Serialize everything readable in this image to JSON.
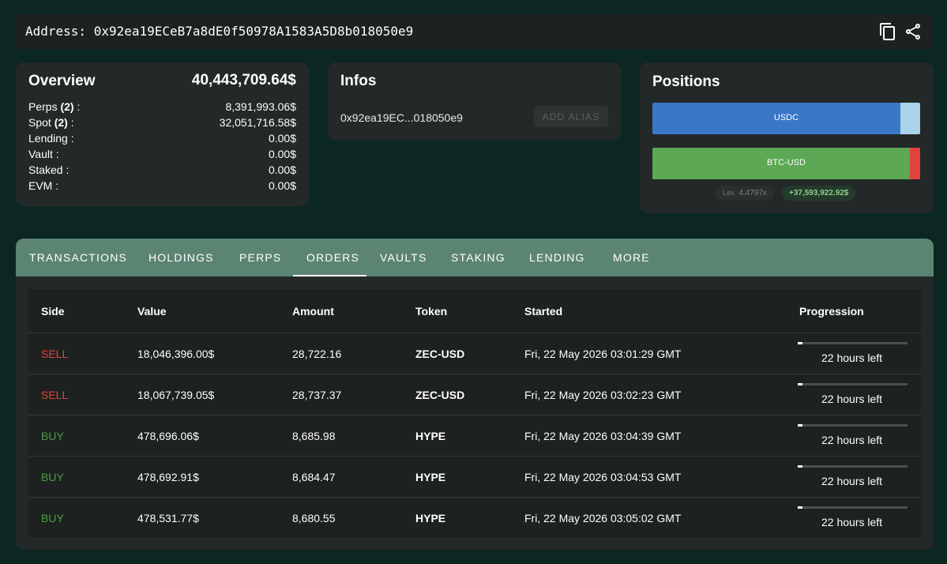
{
  "address_bar": {
    "label": "Address:",
    "address": "0x92ea19ECeB7a8dE0f50978A1583A5D8b018050e9"
  },
  "overview": {
    "title": "Overview",
    "total": "40,443,709.64$",
    "rows": [
      {
        "label": "Perps",
        "count": "(2)",
        "suffix": " :",
        "value": "8,391,993.06$"
      },
      {
        "label": "Spot",
        "count": "(2)",
        "suffix": " :",
        "value": "32,051,716.58$"
      },
      {
        "label": "Lending",
        "count": "",
        "suffix": " :",
        "value": "0.00$"
      },
      {
        "label": "Vault",
        "count": "",
        "suffix": " :",
        "value": "0.00$"
      },
      {
        "label": "Staked",
        "count": "",
        "suffix": " :",
        "value": "0.00$"
      },
      {
        "label": "EVM",
        "count": "",
        "suffix": " :",
        "value": "0.00$"
      }
    ]
  },
  "infos": {
    "title": "Infos",
    "short_address": "0x92ea19EC...018050e9",
    "add_alias_label": "ADD ALIAS"
  },
  "positions": {
    "title": "Positions",
    "bars": [
      {
        "label": "USDC",
        "fill_fraction": 0.925,
        "fill_color": "#3a77c8",
        "rest_color": "#acd3ec"
      },
      {
        "label": "BTC-USD",
        "fill_fraction": 0.962,
        "fill_color": "#5ca854",
        "rest_color": "#e2443b"
      }
    ],
    "leverage_prefix": "Lev.",
    "leverage_value": "4.4797x",
    "pnl": "+37,593,922.92$"
  },
  "tabs": [
    {
      "label": "TRANSACTIONS"
    },
    {
      "label": "HOLDINGS"
    },
    {
      "label": "PERPS"
    },
    {
      "label": "ORDERS"
    },
    {
      "label": "VAULTS"
    },
    {
      "label": "STAKING"
    },
    {
      "label": "LENDING"
    },
    {
      "label": "MORE"
    }
  ],
  "active_tab": "ORDERS",
  "orders": {
    "headers": {
      "side": "Side",
      "value": "Value",
      "amount": "Amount",
      "token": "Token",
      "started": "Started",
      "progression": "Progression"
    },
    "rows": [
      {
        "side": "SELL",
        "value": "18,046,396.00$",
        "amount": "28,722.16",
        "token": "ZEC-USD",
        "started": "Fri, 22 May 2026 03:01:29 GMT",
        "progress": 0.04,
        "time_left": "22 hours left"
      },
      {
        "side": "SELL",
        "value": "18,067,739.05$",
        "amount": "28,737.37",
        "token": "ZEC-USD",
        "started": "Fri, 22 May 2026 03:02:23 GMT",
        "progress": 0.04,
        "time_left": "22 hours left"
      },
      {
        "side": "BUY",
        "value": "478,696.06$",
        "amount": "8,685.98",
        "token": "HYPE",
        "started": "Fri, 22 May 2026 03:04:39 GMT",
        "progress": 0.04,
        "time_left": "22 hours left"
      },
      {
        "side": "BUY",
        "value": "478,692.91$",
        "amount": "8,684.47",
        "token": "HYPE",
        "started": "Fri, 22 May 2026 03:04:53 GMT",
        "progress": 0.04,
        "time_left": "22 hours left"
      },
      {
        "side": "BUY",
        "value": "478,531.77$",
        "amount": "8,680.55",
        "token": "HYPE",
        "started": "Fri, 22 May 2026 03:05:02 GMT",
        "progress": 0.04,
        "time_left": "22 hours left"
      }
    ]
  },
  "colors": {
    "background": "#0c2722",
    "card": "#232928",
    "tab_bar": "#5b8473",
    "sell": "#e2443b",
    "buy": "#4d9a45"
  },
  "icons": {
    "copy": "copy-icon",
    "share": "share-icon"
  }
}
